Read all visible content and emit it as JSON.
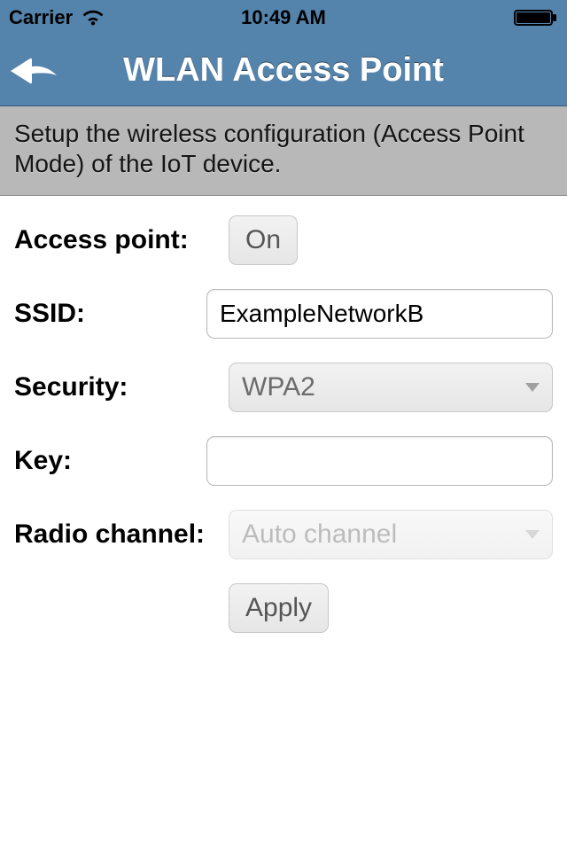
{
  "status": {
    "carrier": "Carrier",
    "time": "10:49 AM"
  },
  "nav": {
    "title": "WLAN Access Point"
  },
  "desc": "Setup the wireless configuration (Access Point Mode) of the IoT device.",
  "form": {
    "access_point": {
      "label": "Access point:",
      "toggle": "On"
    },
    "ssid": {
      "label": "SSID:",
      "value": "ExampleNetworkB"
    },
    "security": {
      "label": "Security:",
      "value": "WPA2"
    },
    "key": {
      "label": "Key:",
      "value": ""
    },
    "radio": {
      "label": "Radio channel:",
      "value": "Auto channel"
    },
    "apply": {
      "label": "Apply"
    }
  }
}
